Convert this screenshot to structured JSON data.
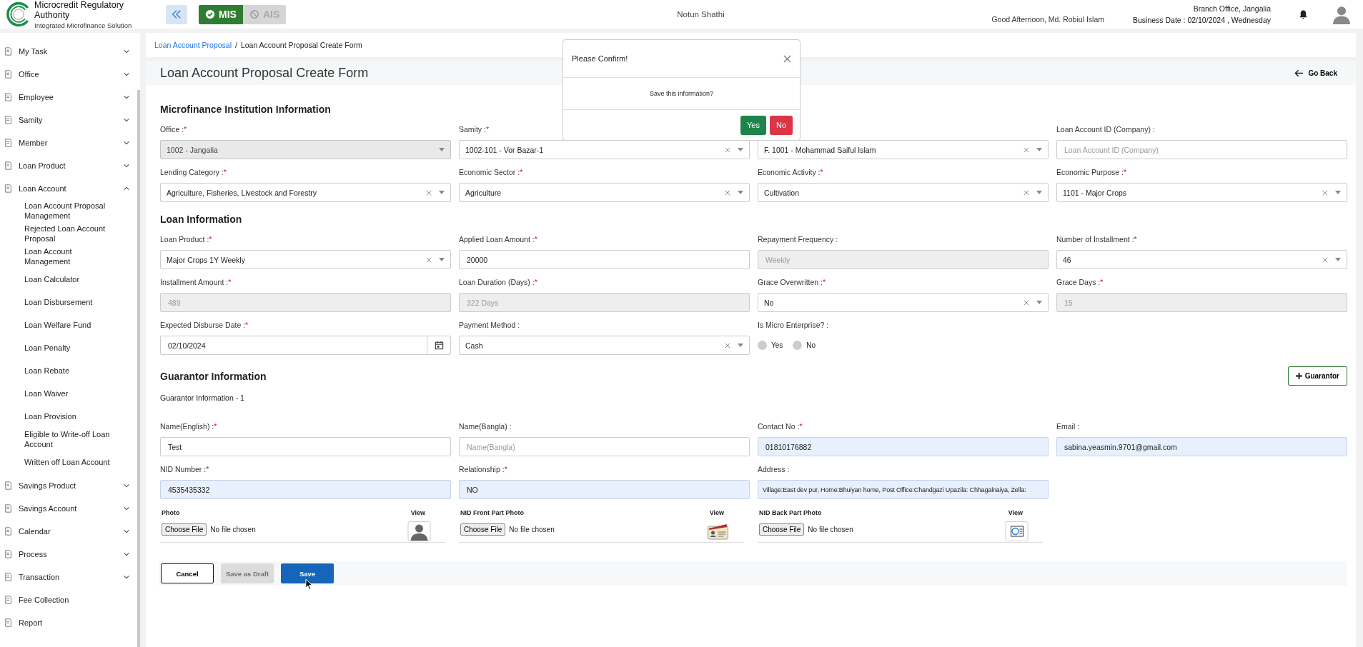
{
  "header": {
    "title": "Microcredit Regulatory Authority",
    "subtitle": "Integrated Microfinance Solution",
    "modules": [
      {
        "label": "MIS",
        "selected": true
      },
      {
        "label": "AIS",
        "selected": false
      }
    ],
    "organization": "Notun Shathi",
    "greeting": "Good Afternoon, Md. Robiul Islam",
    "branch": "Branch Office, Jangalia",
    "business_date": "Business Date : 02/10/2024 , Wednesday"
  },
  "sidebar": {
    "items": [
      {
        "label": "My Task",
        "expanded": false
      },
      {
        "label": "Office",
        "expanded": false
      },
      {
        "label": "Employee",
        "expanded": false
      },
      {
        "label": "Samity",
        "expanded": false
      },
      {
        "label": "Member",
        "expanded": false
      },
      {
        "label": "Loan Product",
        "expanded": false
      },
      {
        "label": "Loan Account",
        "expanded": true,
        "children": [
          {
            "label": "Loan Account Proposal Management"
          },
          {
            "label": "Rejected Loan Account Proposal"
          },
          {
            "label": "Loan Account Management"
          },
          {
            "label": "Loan Calculator"
          },
          {
            "label": "Loan Disbursement"
          },
          {
            "label": "Loan Welfare Fund"
          },
          {
            "label": "Loan Penalty"
          },
          {
            "label": "Loan Rebate"
          },
          {
            "label": "Loan Waiver"
          },
          {
            "label": "Loan Provision"
          },
          {
            "label": "Eligible to Write-off Loan Account"
          },
          {
            "label": "Written off Loan Account"
          }
        ]
      },
      {
        "label": "Savings Product",
        "expanded": false
      },
      {
        "label": "Savings Account",
        "expanded": false
      },
      {
        "label": "Calendar",
        "expanded": false
      },
      {
        "label": "Process",
        "expanded": false
      },
      {
        "label": "Transaction",
        "expanded": false
      },
      {
        "label": "Fee Collection"
      },
      {
        "label": "Report"
      }
    ]
  },
  "breadcrumb": [
    {
      "label": "Loan Account Proposal",
      "kind": "link"
    },
    {
      "label": "Loan Account Proposal Create Form",
      "kind": "current",
      "separator": "/"
    }
  ],
  "page_title": "Loan Account Proposal Create Form",
  "go_back": "Go Back",
  "sections": [
    {
      "title": "Microfinance Institution Information",
      "fields": [
        {
          "label": "Office :",
          "mark": "*",
          "kind": "select",
          "value": "1002 - Jangalia",
          "clearable": false,
          "disabled": true
        },
        {
          "label": "Samity :",
          "mark": "*",
          "kind": "select",
          "value": "1002-101 - Vor Bazar-1",
          "clearable": true,
          "disabled": false
        },
        {
          "kind": "select",
          "value": "F. 1001 - Mohammad Saiful Islam",
          "clearable": true,
          "disabled": false
        },
        {
          "label": "Loan Account ID (Company) :",
          "kind": "text",
          "placeholder": "Loan Account ID (Company)"
        },
        {
          "label": "Lending Category :",
          "mark": "*",
          "kind": "select",
          "value": "Agriculture, Fisheries, Livestock and Forestry",
          "clearable": true,
          "disabled": false
        },
        {
          "label": "Economic Sector :",
          "mark": "*",
          "kind": "select",
          "value": "Agriculture",
          "clearable": true,
          "disabled": false
        },
        {
          "label": "Economic Activity :",
          "mark": "*",
          "kind": "select",
          "value": "Cultivation",
          "clearable": true,
          "disabled": false
        },
        {
          "label": "Economic Purpose :",
          "mark": "*",
          "kind": "select",
          "value": "1101 - Major Crops",
          "clearable": true,
          "disabled": false
        }
      ]
    },
    {
      "title": "Loan Information",
      "fields": [
        {
          "label": "Loan Product :",
          "mark": "*",
          "kind": "select",
          "value": "Major Crops 1Y Weekly",
          "clearable": true,
          "disabled": false
        },
        {
          "label": "Applied Loan Amount :",
          "mark": "*",
          "kind": "text",
          "value": "20000"
        },
        {
          "label": "Repayment Frequency :",
          "kind": "readonly",
          "value": "Weekly"
        },
        {
          "label": "Number of Installment :",
          "mark": "*",
          "kind": "select",
          "value": "46",
          "clearable": true,
          "disabled": false
        },
        {
          "label": "Installment Amount :",
          "mark": "*",
          "kind": "readonly",
          "value": "489"
        },
        {
          "label": "Loan Duration (Days) :",
          "mark": "*",
          "kind": "readonly",
          "value": "322 Days"
        },
        {
          "label": "Grace Overwritten :",
          "mark": "*",
          "kind": "select",
          "value": "No",
          "clearable": true,
          "disabled": false
        },
        {
          "label": "Grace Days :",
          "mark": "*",
          "kind": "readonly",
          "value": "15"
        },
        {
          "label": "Expected Disburse Date :",
          "mark": "*",
          "kind": "date",
          "value": "02/10/2024"
        },
        {
          "label": "Payment Method :",
          "kind": "select",
          "value": "Cash",
          "clearable": true,
          "disabled": false
        },
        {
          "label": "Is Micro Enterprise? :",
          "kind": "radio",
          "options": [
            {
              "label": "Yes",
              "selected": false
            },
            {
              "label": "No",
              "selected": false
            }
          ]
        }
      ]
    }
  ],
  "guarantor": {
    "title": "Guarantor Information",
    "add_button": "Guarantor",
    "subtitle": "Guarantor Information - 1",
    "fields": [
      {
        "label": "Name(English) :",
        "mark": "*",
        "kind": "text",
        "value": "Test",
        "autofilled": false
      },
      {
        "label": "Name(Bangla) :",
        "kind": "text",
        "placeholder": "Name(Bangla)",
        "autofilled": false
      },
      {
        "label": "Contact No :",
        "mark": "*",
        "kind": "text",
        "value": "01810176882",
        "autofilled": true
      },
      {
        "label": "Email :",
        "kind": "text",
        "value": "sabina.yeasmin.9701@gmail.com",
        "autofilled": true
      },
      {
        "label": "NID Number :",
        "mark": "*",
        "kind": "text",
        "value": "4535435332",
        "autofilled": true
      },
      {
        "label": "Relationship :",
        "mark": "*",
        "kind": "text",
        "value": "NO",
        "autofilled": true
      },
      {
        "label": "Address :",
        "kind": "text",
        "value": "Village:East dev pur, Home:Bhuiyan home, Post Office:Chandgazi Upazila: Chhagalnaiya, Zella:",
        "autofilled": true
      }
    ],
    "uploads": [
      {
        "label": "Photo",
        "view": "View",
        "button": "Choose File",
        "status": "No file chosen",
        "kind": "person"
      },
      {
        "label": "NID Front Part Photo",
        "view": "View",
        "button": "Choose File",
        "status": "No file chosen",
        "kind": "card"
      },
      {
        "label": "NID Back Part Photo",
        "view": "View",
        "button": "Choose File",
        "status": "No file chosen",
        "kind": "document"
      }
    ]
  },
  "actions": [
    {
      "label": "Cancel",
      "kind": "cancel",
      "disabled": false
    },
    {
      "label": "Save as Draft",
      "kind": "draft",
      "disabled": true
    },
    {
      "label": "Save",
      "kind": "primary",
      "disabled": false
    }
  ],
  "dialog": {
    "title": "Please Confirm!",
    "message": "Save this information?",
    "buttons": [
      {
        "label": "Yes",
        "kind": "confirm"
      },
      {
        "label": "No",
        "kind": "deny"
      }
    ]
  }
}
